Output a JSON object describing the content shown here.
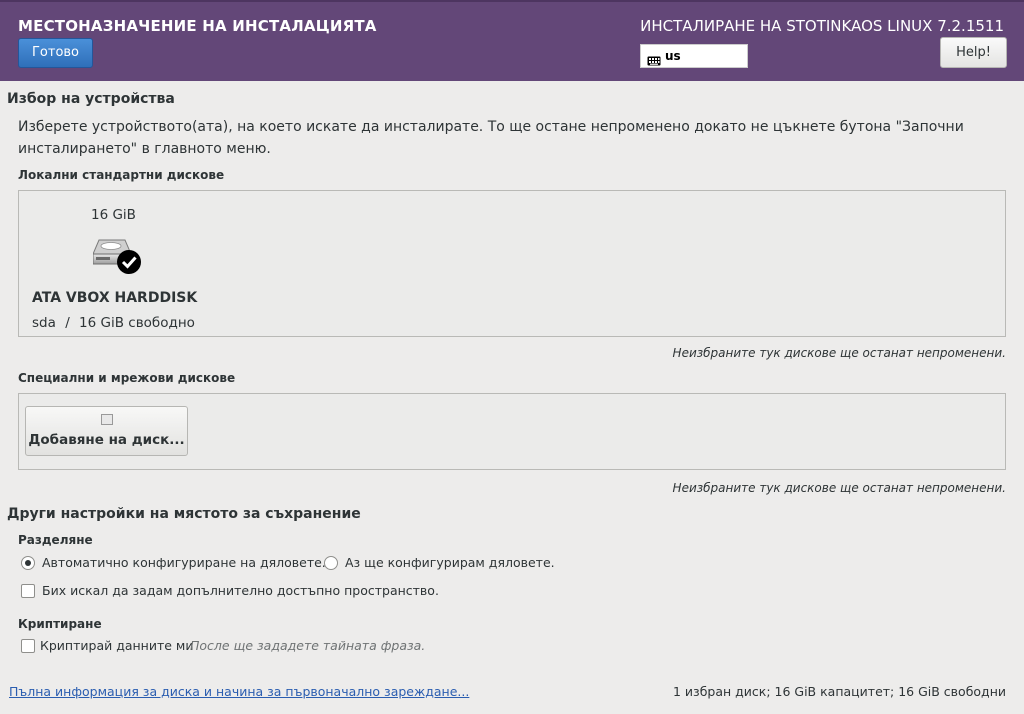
{
  "header": {
    "title": "МЕСТОНАЗНАЧЕНИЕ НА ИНСТАЛАЦИЯТА",
    "product": "ИНСТАЛИРАНЕ НА STOTINKAOS LINUX 7.2.1511",
    "done_label": "Готово",
    "keyboard_layout": "us",
    "help_label": "Help!"
  },
  "device_selection": {
    "title": "Избор на устройства",
    "description_line1": "Изберете устройството(ата), на което искате да инсталирате.  То ще остане непроменено докато не цъкнете бутона \"Започни",
    "description_line2": "инсталирането\" в главното меню.",
    "local_disks_title": "Локални стандартни дискове",
    "disks": [
      {
        "size": "16 GiB",
        "name": "ATA VBOX HARDDISK",
        "device": "sda",
        "separator": "/",
        "free": "16 GiB свободно",
        "selected": true
      }
    ],
    "unselected_note": "Неизбраните тук дискове ще останат непроменени.",
    "special_disks_title": "Специални и мрежови дискове",
    "add_disk_label": "Добавяне на диск...",
    "special_unselected_note": "Неизбраните тук дискове ще останат непроменени."
  },
  "storage_options": {
    "title": "Други настройки на мястото за съхранение",
    "partitioning_title": "Разделяне",
    "auto_partition_label": "Автоматично конфигуриране на дяловете.",
    "manual_partition_label": "Аз ще конфигурирам дяловете.",
    "selected_partitioning": "auto",
    "extra_space_label": "Бих искал да задам допълнително достъпно пространство.",
    "extra_space_checked": false,
    "encryption_title": "Криптиране",
    "encrypt_label": "Криптирай данните ми",
    "encrypt_hint": "После ще зададете тайната фраза.",
    "encrypt_checked": false
  },
  "footer": {
    "link": "Пълна информация за диска и начина за първоначално зареждане...",
    "summary": "1 избран диск; 16 GiB капацитет; 16 GiB свободни"
  },
  "colors": {
    "header_bg": "#634778",
    "accent_button": "#3a7cc7",
    "link": "#2a5db0"
  }
}
